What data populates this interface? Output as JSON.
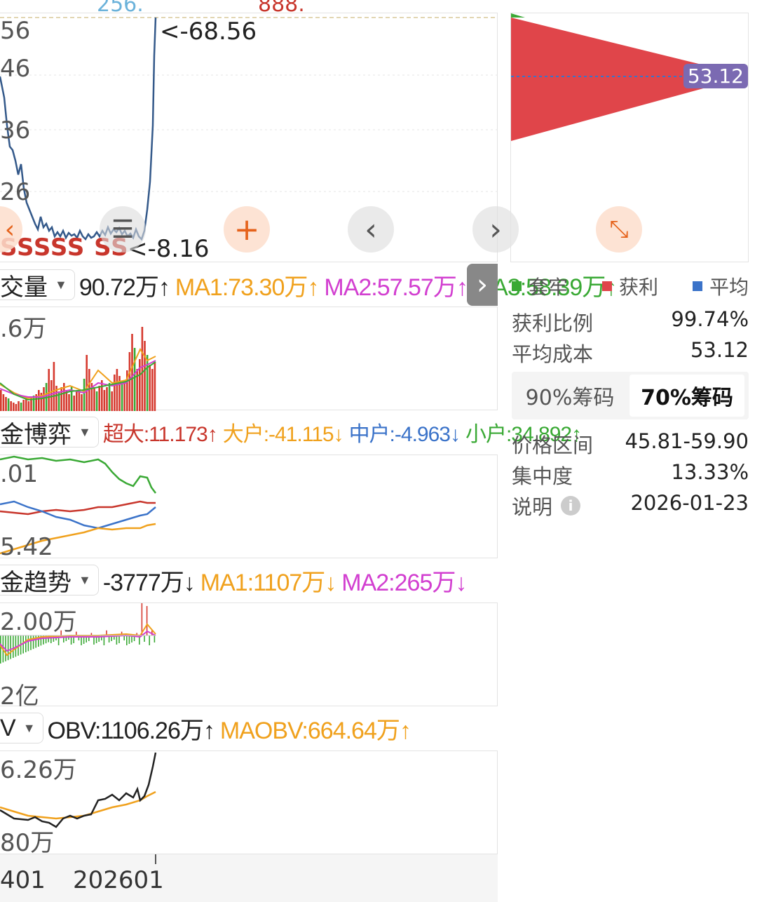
{
  "price_chart": {
    "top_partial_labels": [
      "256.",
      "888."
    ],
    "y_labels": [
      "56",
      "46",
      "36",
      "26"
    ],
    "high_marker": "<-68.56",
    "low_marker": "<-8.16",
    "signal_text": "SSSSS SS"
  },
  "chart_controls": {
    "prev_left_icon": "chevron-left-icon",
    "menu_icon": "menu-icon",
    "zoom_in_icon": "plus-icon",
    "prev_icon": "chevron-left-icon",
    "next_icon": "chevron-right-icon",
    "expand_icon": "expand-icon"
  },
  "volume": {
    "selector": "交量",
    "value": "90.72万↑",
    "ma1": "MA1:73.30万↑",
    "ma2": "MA2:57.57万↑",
    "ma3": "MA3:58.39万↑",
    "y_top": ".6万"
  },
  "fund_game": {
    "selector": "金博弈",
    "super_large": "超大:11.173↑",
    "large": "大户:-41.115↓",
    "medium": "中户:-4.963↓",
    "small": "小户:34.892↑",
    "y_top": ".01",
    "y_bottom": "5.42"
  },
  "fund_trend": {
    "selector": "金趋势",
    "value": "-3777万↓",
    "ma1": "MA1:1107万↓",
    "ma2": "MA2:265万↓",
    "y_top": "2.00万",
    "y_bottom": "2亿"
  },
  "obv": {
    "selector": "V",
    "value": "OBV:1106.26万↑",
    "maobv": "MAOBV:664.64万↑",
    "y_top": "6.26万",
    "y_bottom": "80万"
  },
  "x_axis": {
    "labels": [
      "401",
      "202601"
    ]
  },
  "chip": {
    "avg_price_tag": "53.12",
    "legend": {
      "trapped": "套牢",
      "profit": "获利",
      "average": "平均"
    },
    "profit_ratio_label": "获利比例",
    "profit_ratio_value": "99.74%",
    "avg_cost_label": "平均成本",
    "avg_cost_value": "53.12",
    "tabs": [
      "90%筹码",
      "70%筹码"
    ],
    "active_tab": "70%筹码",
    "price_range_label": "价格区间",
    "price_range_value": "45.81-59.90",
    "concentration_label": "集中度",
    "concentration_value": "13.33%",
    "note_label": "说明",
    "note_value": "2026-01-23"
  },
  "colors": {
    "red": "#e0454a",
    "green": "#3aa935",
    "blue": "#3b73c9",
    "orange": "#f0a11d",
    "magenta": "#d23fd0",
    "dark_blue": "#34598a",
    "purple_tag": "#7b6ab2",
    "dark_red": "#c8362c"
  }
}
